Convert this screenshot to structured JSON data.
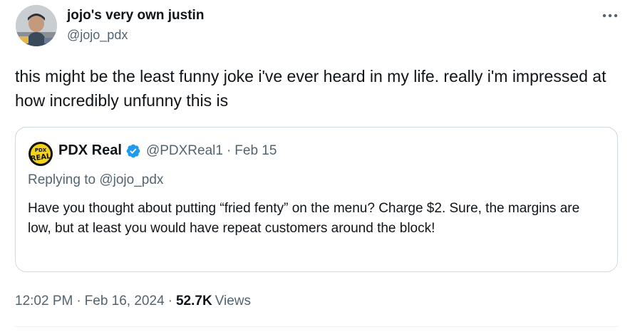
{
  "tweet": {
    "author": {
      "display_name": "jojo's very own justin",
      "handle": "@jojo_pdx",
      "avatar_icon": "profile-photo"
    },
    "text": "this might be the least funny joke i've ever heard in my life. really i'm impressed at how incredibly unfunny this is",
    "more_icon": "more-icon",
    "quote": {
      "author_name": "PDX Real",
      "verified": true,
      "handle": "@PDXReal1",
      "separator": "·",
      "date": "Feb 15",
      "replying_to": "Replying to @jojo_pdx",
      "text": "Have you thought about putting “fried fenty” on the menu? Charge $2. Sure, the margins are low, but at least you would have repeat customers around the block!",
      "logo_text_top": "PDX",
      "logo_text_bottom": "REAL"
    },
    "meta": {
      "time": "12:02 PM",
      "separator": "·",
      "date": "Feb 16, 2024",
      "views_count": "52.7K",
      "views_label": "Views"
    }
  },
  "colors": {
    "primary_text": "#0f1419",
    "secondary_text": "#536471",
    "border": "#cfd9de",
    "verified_blue": "#1d9bf0"
  }
}
